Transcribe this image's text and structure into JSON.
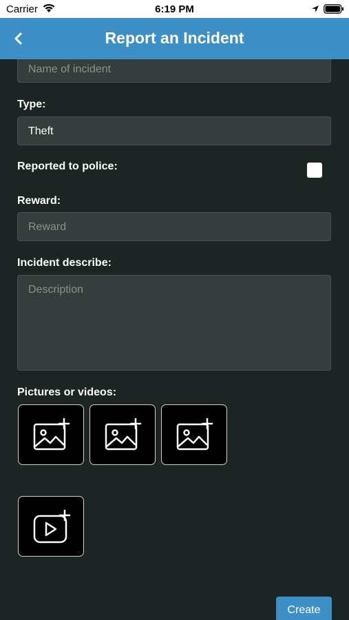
{
  "status_bar": {
    "carrier": "Carrier",
    "time": "6:19 PM"
  },
  "nav": {
    "title": "Report an Incident"
  },
  "form": {
    "name_placeholder": "Name of incident",
    "type_label": "Type:",
    "type_value": "Theft",
    "police_label": "Reported to police:",
    "police_checked": false,
    "reward_label": "Reward:",
    "reward_placeholder": "Reward",
    "describe_label": "Incident describe:",
    "description_placeholder": "Description",
    "media_label": "Pictures or videos:",
    "media_tiles": [
      "add-image-icon",
      "add-image-icon",
      "add-image-icon",
      "add-video-icon"
    ]
  },
  "actions": {
    "create_label": "Create"
  },
  "colors": {
    "accent": "#3f8fc7",
    "background": "#1c2523",
    "field": "#353e3d"
  }
}
